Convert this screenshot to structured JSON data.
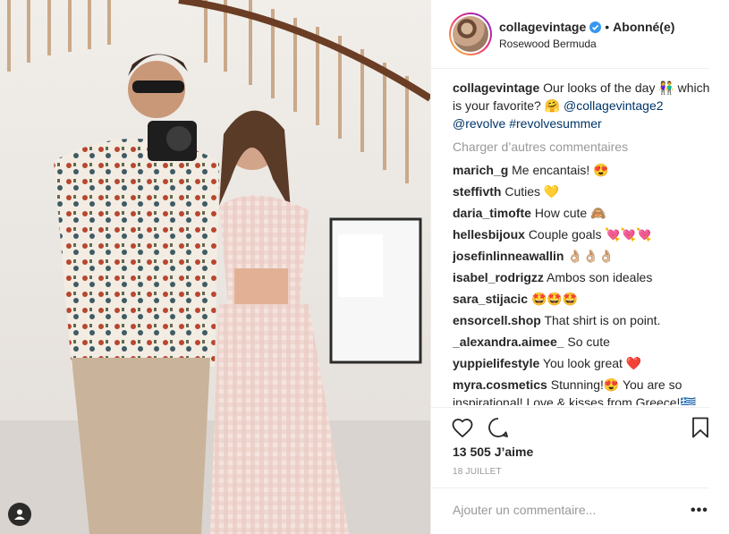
{
  "post": {
    "image_alt": "Couple posing with a camera in front of a staircase",
    "tag_icon": "user-tag-icon"
  },
  "header": {
    "username": "collagevintage",
    "verified_icon": "verified-badge-icon",
    "separator": "•",
    "follow_state": "Abonné(e)",
    "location": "Rosewood Bermuda"
  },
  "caption": {
    "user": "collagevintage",
    "text_1": " Our looks of the day 👫 which is your favorite? 🤗 ",
    "mention": "@collagevintage2",
    "mention2": "@revolve",
    "hashtag": "#revolvesummer"
  },
  "load_more": "Charger d’autres commentaires",
  "comments": [
    {
      "user": "marich_g",
      "text": "Me encantais! 😍"
    },
    {
      "user": "steffivth",
      "text": "Cuties 💛"
    },
    {
      "user": "daria_timofte",
      "text": "How cute 🙈"
    },
    {
      "user": "hellesbijoux",
      "text": "Couple goals 💘💘💘"
    },
    {
      "user": "josefinlinneawallin",
      "text": "👌🏼👌🏼👌🏼"
    },
    {
      "user": "isabel_rodrigzz",
      "text": "Ambos son ideales"
    },
    {
      "user": "sara_stijacic",
      "text": "🤩🤩🤩"
    },
    {
      "user": "ensorcell.shop",
      "text": "That shirt is on point."
    },
    {
      "user": "_alexandra.aimee_",
      "text": "So cute"
    },
    {
      "user": "yuppielifestyle",
      "text": "You look great ❤️"
    },
    {
      "user": "myra.cosmetics",
      "text": "Stunning!😍 You are so inspirational! Love & kisses from Greece!🇬🇷"
    }
  ],
  "actions": {
    "like_icon": "heart-icon",
    "comment_icon": "comment-bubble-icon",
    "save_icon": "bookmark-icon"
  },
  "likes": "13 505 J’aime",
  "date": "18 JUILLET",
  "add_comment": {
    "placeholder": "Ajouter un commentaire...",
    "more_label": "•••"
  }
}
